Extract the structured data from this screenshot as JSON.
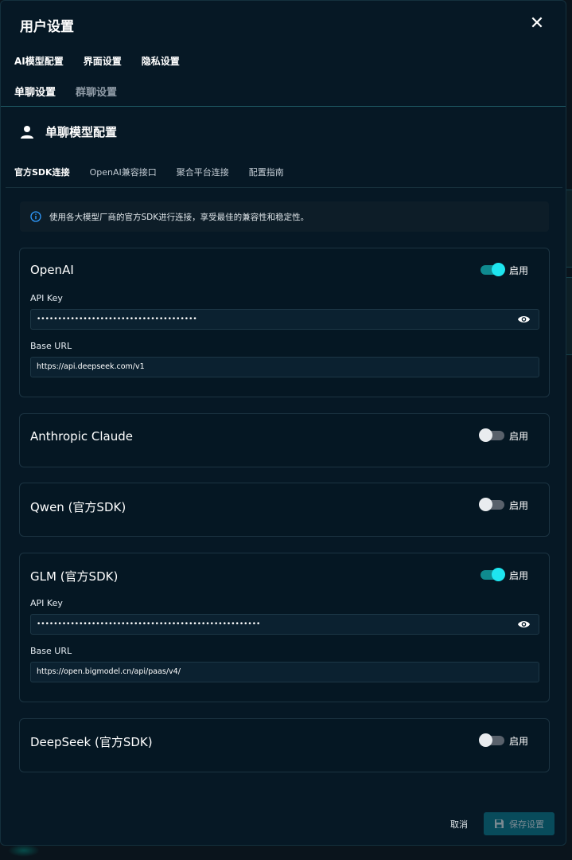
{
  "dialog": {
    "title": "用户设置",
    "close_label": "✕"
  },
  "top_tabs": [
    "AI模型配置",
    "界面设置",
    "隐私设置"
  ],
  "sub_tabs": [
    {
      "label": "单聊设置",
      "active": true
    },
    {
      "label": "群聊设置",
      "active": false
    }
  ],
  "section": {
    "title": "单聊模型配置",
    "icon": "user-icon"
  },
  "config_tabs": [
    {
      "label": "官方SDK连接",
      "active": true
    },
    {
      "label": "OpenAI兼容接口",
      "active": false
    },
    {
      "label": "聚合平台连接",
      "active": false
    },
    {
      "label": "配置指南",
      "active": false
    }
  ],
  "info": {
    "icon": "info-icon",
    "text": "使用各大模型厂商的官方SDK进行连接，享受最佳的兼容性和稳定性。"
  },
  "providers": [
    {
      "name": "OpenAI",
      "enabled": true,
      "toggle_label": "启用",
      "api_key_label": "API Key",
      "api_key_masked": "••••••••••••••••••••••••••••••••••••••",
      "base_url_label": "Base URL",
      "base_url": "https://api.deepseek.com/v1"
    },
    {
      "name": "Anthropic Claude",
      "enabled": false,
      "toggle_label": "启用"
    },
    {
      "name": "Qwen (官方SDK)",
      "enabled": false,
      "toggle_label": "启用"
    },
    {
      "name": "GLM (官方SDK)",
      "enabled": true,
      "toggle_label": "启用",
      "api_key_label": "API Key",
      "api_key_masked": "•••••••••••••••••••••••••••••••••••••••••••••••••••••",
      "base_url_label": "Base URL",
      "base_url": "https://open.bigmodel.cn/api/paas/v4/"
    },
    {
      "name": "DeepSeek (官方SDK)",
      "enabled": false,
      "toggle_label": "启用"
    }
  ],
  "footer": {
    "cancel_label": "取消",
    "save_label": "保存设置"
  },
  "colors": {
    "accent": "#1ee5ef",
    "background": "#061825",
    "toggle_on_track": "#0f8a8f"
  }
}
